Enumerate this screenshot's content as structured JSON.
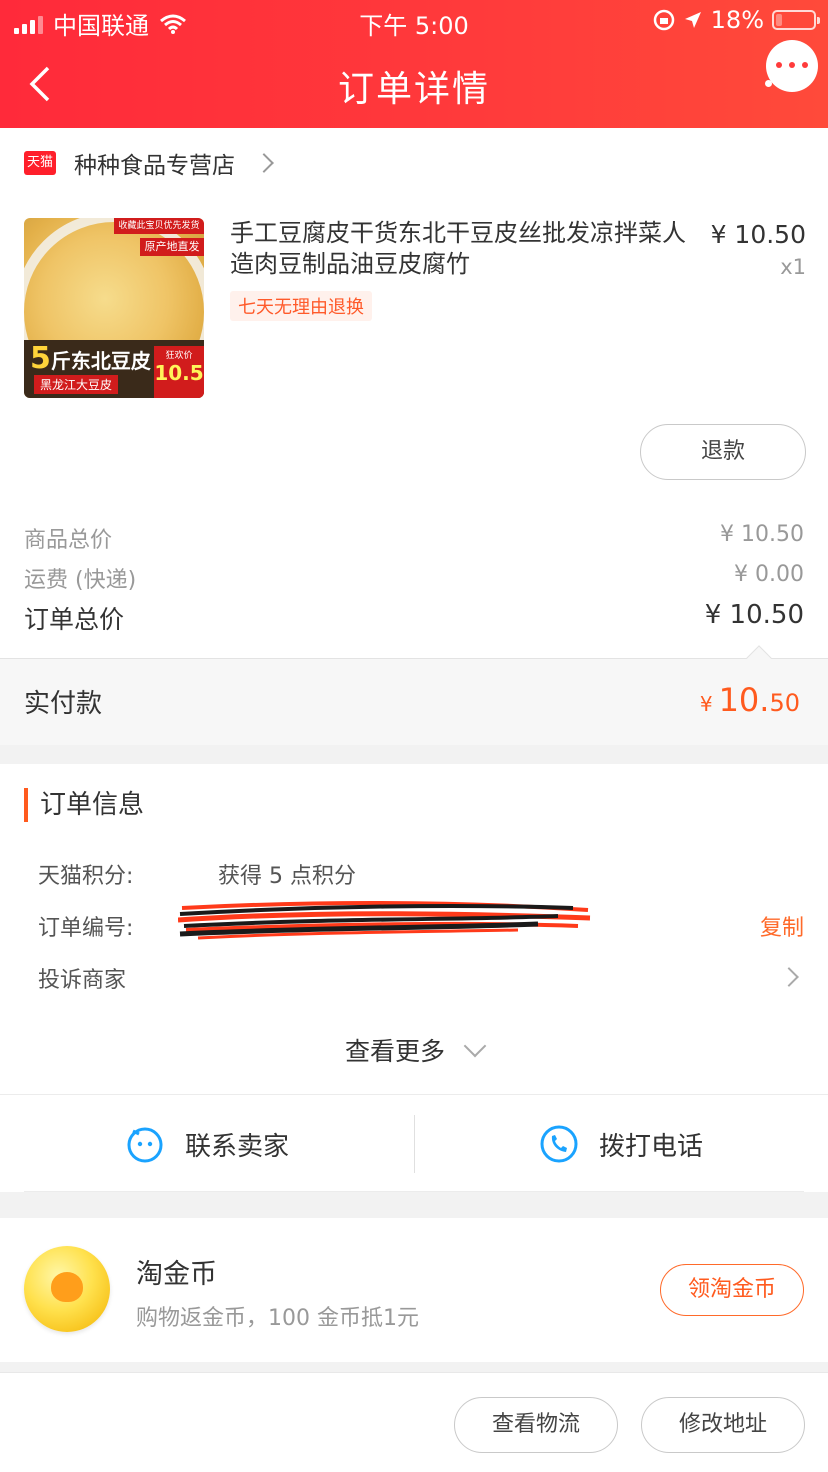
{
  "status_bar": {
    "carrier": "中国联通",
    "time": "下午 5:00",
    "battery": "18%",
    "battery_level": 0.18
  },
  "header": {
    "title": "订单详情",
    "back_icon": "back-arrow-icon",
    "more_icon": "more-dots-icon"
  },
  "store": {
    "badge": "天猫",
    "name": "种种食品专营店"
  },
  "product": {
    "title": "手工豆腐皮干货东北干豆皮丝批发凉拌菜人造肉豆制品油豆皮腐竹",
    "price": "¥ 10.50",
    "quantity": "x1",
    "return_tag": "七天无理由退换",
    "image_text": {
      "tag1": "收藏此宝贝优先发货",
      "tag2": "原产地直发",
      "big_num": "5",
      "big_text": "斤东北豆皮",
      "sub": "黑龙江大豆皮",
      "price_small": "狂欢价",
      "price_big": "10.5"
    }
  },
  "refund_button": "退款",
  "prices": {
    "goods_label": "商品总价",
    "goods_value": "¥ 10.50",
    "shipping_label": "运费 (快递)",
    "shipping_value": "¥ 0.00",
    "total_label": "订单总价",
    "total_value": "¥ 10.50"
  },
  "paid": {
    "label": "实付款",
    "currency": "¥",
    "int_part": "10.",
    "dec_part": "50"
  },
  "order_info": {
    "title": "订单信息",
    "points_label": "天猫积分:",
    "points_value": "获得 5 点积分",
    "order_no_label": "订单编号:",
    "copy": "复制",
    "complain_label": "投诉商家",
    "see_more": "查看更多"
  },
  "contact": {
    "seller": "联系卖家",
    "call": "拨打电话"
  },
  "coin": {
    "title": "淘金币",
    "subtitle": "购物返金币，100 金币抵1元",
    "button": "领淘金币"
  },
  "bottom_actions": {
    "logistics": "查看物流",
    "address": "修改地址"
  },
  "colors": {
    "header_red": "#ff2a3a",
    "accent_orange": "#ff5a1e"
  }
}
